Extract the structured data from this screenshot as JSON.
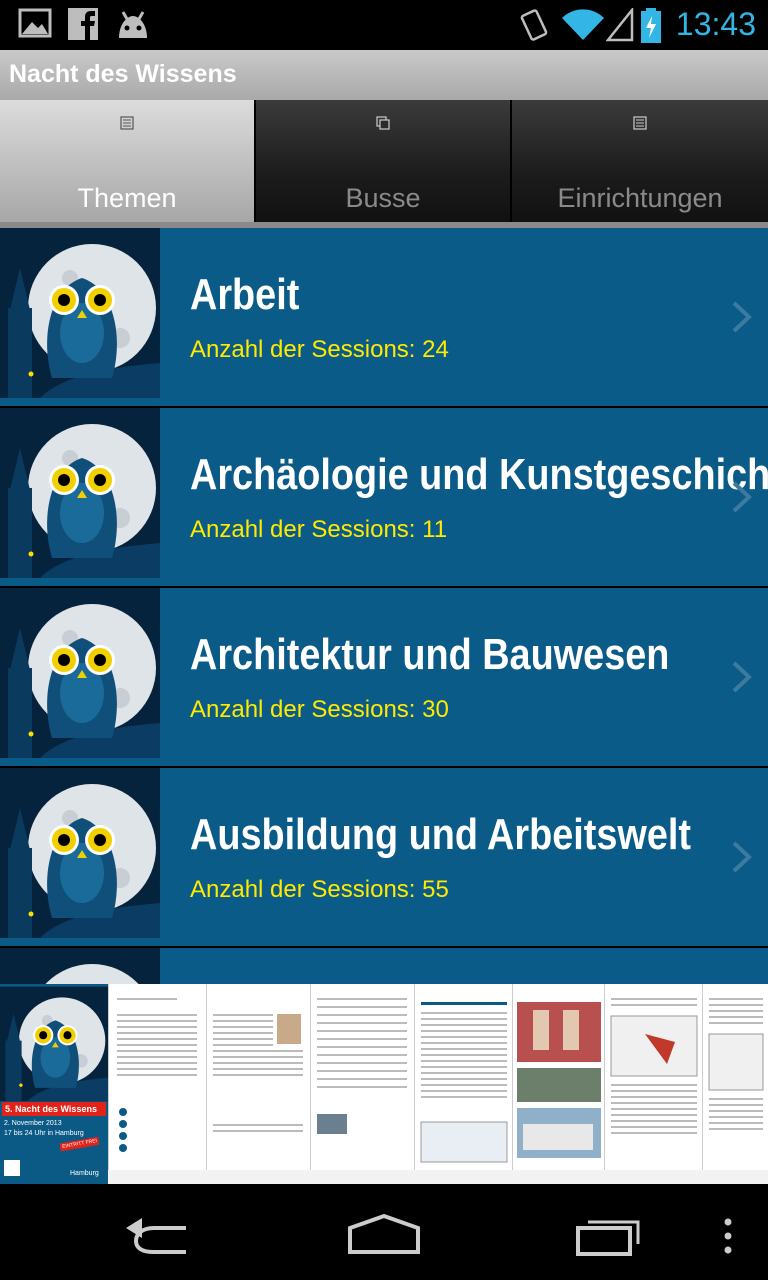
{
  "status_bar": {
    "time": "13:43",
    "icons": [
      "image-icon",
      "facebook-icon",
      "android-icon",
      "rotate-icon",
      "wifi-icon",
      "signal-icon",
      "battery-icon"
    ]
  },
  "app": {
    "title": "Nacht des Wissens"
  },
  "tabs": [
    {
      "label": "Themen",
      "icon": "list-icon",
      "active": true
    },
    {
      "label": "Busse",
      "icon": "copy-icon",
      "active": false
    },
    {
      "label": "Einrichtungen",
      "icon": "list-icon",
      "active": false
    }
  ],
  "topics": [
    {
      "title": "Arbeit",
      "sessions": "Anzahl der Sessions: 24"
    },
    {
      "title": "Archäologie und Kunstgeschichte",
      "sessions": "Anzahl der Sessions: 11"
    },
    {
      "title": "Architektur und Bauwesen",
      "sessions": "Anzahl der Sessions: 30"
    },
    {
      "title": "Ausbildung und Arbeitswelt",
      "sessions": "Anzahl der Sessions: 55"
    }
  ],
  "brochure": {
    "event": "5. Nacht des Wissens",
    "date": "2. November 2013",
    "time": "17 bis 24 Uhr in Hamburg",
    "badge": "EINTRITT FREI",
    "city": "Hamburg"
  },
  "colors": {
    "list_bg": "#0a5b87",
    "accent_yellow": "#ffea00",
    "status_blue": "#33b5e5"
  }
}
